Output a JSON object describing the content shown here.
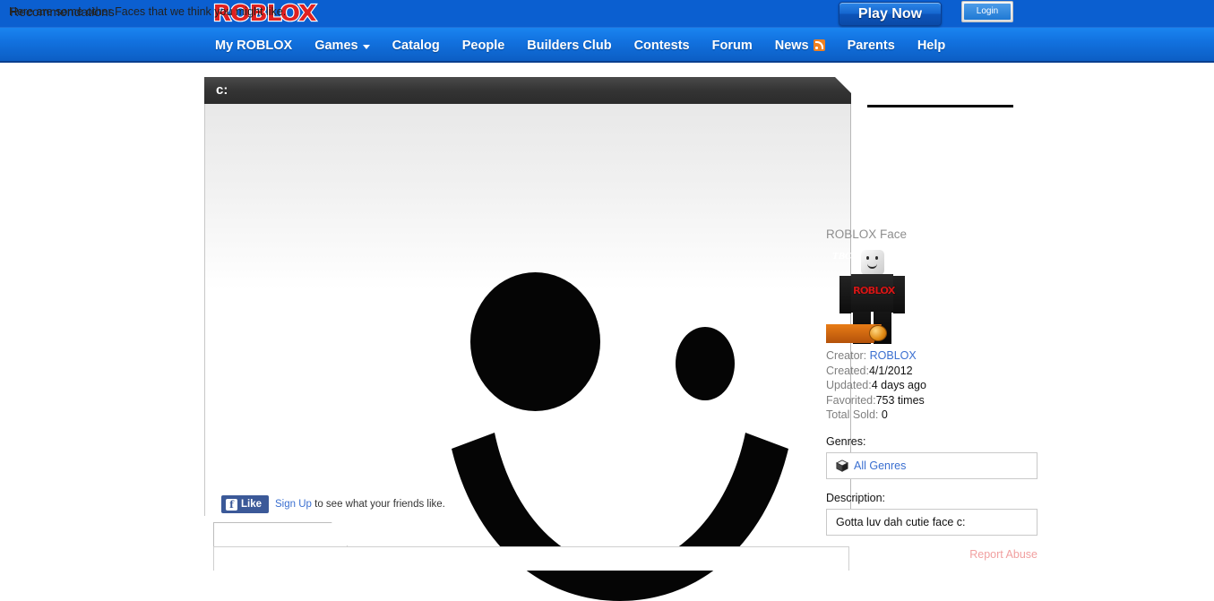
{
  "header": {
    "logo_text": "ROBLOX",
    "play_now_label": "Play Now",
    "login_label": "Login"
  },
  "nav": {
    "items": [
      {
        "label": "My ROBLOX",
        "icon": "none"
      },
      {
        "label": "Games",
        "icon": "chevron-down-icon"
      },
      {
        "label": "Catalog",
        "icon": "none"
      },
      {
        "label": "People",
        "icon": "none"
      },
      {
        "label": "Builders Club",
        "icon": "none"
      },
      {
        "label": "Contests",
        "icon": "none"
      },
      {
        "label": "Forum",
        "icon": "none"
      },
      {
        "label": "News",
        "icon": "rss-icon"
      },
      {
        "label": "Parents",
        "icon": "none"
      },
      {
        "label": "Help",
        "icon": "none"
      }
    ]
  },
  "panel": {
    "title": "c:"
  },
  "item": {
    "name": "ROBLOX Face",
    "avatar_shirt_text": "ROBLOX",
    "membership_badge": "TBC",
    "creator_label": "Creator:",
    "creator_value": "ROBLOX",
    "created_label": "Created:",
    "created_value": "4/1/2012",
    "updated_label": "Updated:",
    "updated_value": "4 days ago",
    "favorited_label": "Favorited:",
    "favorited_value": "753 times",
    "total_sold_label": "Total Sold:",
    "total_sold_value": "0",
    "genres_label": "Genres:",
    "genre_value": "All Genres",
    "description_label": "Description:",
    "description_value": "Gotta luv dah cutie face c:",
    "report_abuse_label": "Report Abuse"
  },
  "social": {
    "like_label": "Like",
    "fb_glyph": "f",
    "signup_label": "Sign Up",
    "signup_suffix": " to see what your friends like."
  },
  "recommendations": {
    "tab_label": "Recommendations",
    "body_text": "Here are some other Faces that we think you might like."
  },
  "colors": {
    "brand_red": "#e02020",
    "nav_blue": "#1272e0",
    "topbar_blue": "#0b5fd0",
    "link_blue": "#3a6fd0",
    "panel_dark": "#343434",
    "tbc_orange": "#e87c16",
    "facebook_blue": "#3b5998",
    "report_pink": "#f1a0a0"
  }
}
